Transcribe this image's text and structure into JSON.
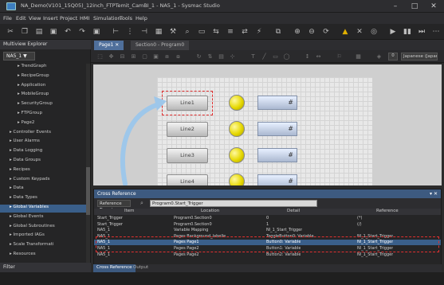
{
  "window": {
    "title": "NA_Demo(V101_15Q05)_12inch_FTPTemit_CamBI_1 - NA5_1 - Sysmac Studio",
    "minimize": "–",
    "maximize": "□",
    "close": "✕"
  },
  "menu": [
    "File",
    "Edit",
    "View",
    "Insert",
    "Project",
    "HMI",
    "Simulation",
    "Tools",
    "Help"
  ],
  "left_pane": {
    "title": "Multiview Explorer",
    "device": "NA5_1 ▼",
    "filter": "Filter",
    "tree": [
      {
        "label": "TrendGraph",
        "sel": false
      },
      {
        "label": "RecipeGroup",
        "sel": false
      },
      {
        "label": "Application",
        "sel": false
      },
      {
        "label": "MobileGroup",
        "sel": false
      },
      {
        "label": "SecurityGroup",
        "sel": false
      },
      {
        "label": "FTPGroup",
        "sel": false
      },
      {
        "label": "Page2",
        "sel": false
      },
      {
        "label": "Controller Events",
        "sel": false
      },
      {
        "label": "User Alarms",
        "sel": false
      },
      {
        "label": "Data Logging",
        "sel": false
      },
      {
        "label": "Data Groups",
        "sel": false
      },
      {
        "label": "Recipes",
        "sel": false
      },
      {
        "label": "Custom Keypads",
        "sel": false
      },
      {
        "label": "Data",
        "sel": false
      },
      {
        "label": "Data Types",
        "sel": false
      },
      {
        "label": "Global Variables",
        "sel": true
      },
      {
        "label": "Global Events",
        "sel": false
      },
      {
        "label": "Global Subroutines",
        "sel": false
      },
      {
        "label": "Imported IAGs",
        "sel": false
      },
      {
        "label": "Scale Transformati",
        "sel": false
      },
      {
        "label": "Resources",
        "sel": false
      }
    ]
  },
  "tabs": [
    {
      "label": "Page1",
      "active": true
    },
    {
      "label": "Section0 - Program0",
      "active": false
    }
  ],
  "doc_toolbar": {
    "zoom": "0",
    "dropdown": "Japanese (Japan)"
  },
  "canvas": {
    "buttons": [
      "Line1",
      "Line2",
      "Line3",
      "Line4"
    ],
    "field_value": "#"
  },
  "cross_reference": {
    "title": "Cross Reference",
    "pin": "▾ ✕",
    "ref_label": "Reference Target",
    "target": "Program0.Start_Trigger",
    "columns": [
      "Item",
      "Location",
      "Detail",
      "Reference"
    ],
    "rows": [
      {
        "item": "Start_Trigger",
        "location": "Program0.Section0",
        "detail": "0",
        "reference": "(*)",
        "sel": false
      },
      {
        "item": "Start_Trigger",
        "location": "Program0.Section0",
        "detail": "1",
        "reference": "(/)",
        "sel": false
      },
      {
        "item": "NA5_1",
        "location": "Variable Mapping",
        "detail": "Nl_1_Start_Trigger",
        "reference": "",
        "sel": false
      },
      {
        "item": "NA5_1",
        "location": "Pages Background_labelle",
        "detail": "ToggleButton0: Variable",
        "reference": "Nl_1_Start_Trigger",
        "sel": false
      },
      {
        "item": "NA5_1",
        "location": "Pages Page1",
        "detail": "Button0: Variable",
        "reference": "Nl_1_Start_Trigger",
        "sel": true
      },
      {
        "item": "NA5_1",
        "location": "Pages Page2",
        "detail": "Button1: Variable",
        "reference": "Nl_1_Start_Trigger",
        "sel": false
      },
      {
        "item": "NA5_1",
        "location": "Pages Page2",
        "detail": "Button2: Variable",
        "reference": "Nl_1_Start_Trigger",
        "sel": false
      }
    ],
    "bottom_tabs": [
      "Cross Reference",
      "Output"
    ]
  },
  "colors": {
    "accent": "#3d5a80",
    "highlight": "#e03030",
    "lamp": "#e6d800",
    "arrow": "#9ec7ea"
  }
}
